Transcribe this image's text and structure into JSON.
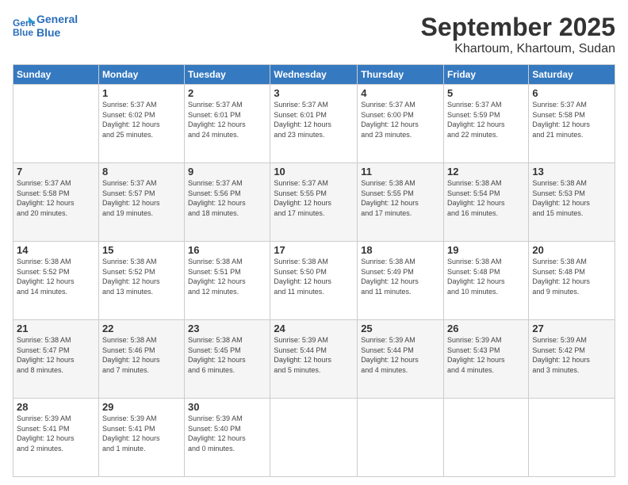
{
  "header": {
    "logo_line1": "General",
    "logo_line2": "Blue",
    "title": "September 2025",
    "subtitle": "Khartoum, Khartoum, Sudan"
  },
  "days_of_week": [
    "Sunday",
    "Monday",
    "Tuesday",
    "Wednesday",
    "Thursday",
    "Friday",
    "Saturday"
  ],
  "weeks": [
    [
      {
        "day": "",
        "info": ""
      },
      {
        "day": "1",
        "info": "Sunrise: 5:37 AM\nSunset: 6:02 PM\nDaylight: 12 hours\nand 25 minutes."
      },
      {
        "day": "2",
        "info": "Sunrise: 5:37 AM\nSunset: 6:01 PM\nDaylight: 12 hours\nand 24 minutes."
      },
      {
        "day": "3",
        "info": "Sunrise: 5:37 AM\nSunset: 6:01 PM\nDaylight: 12 hours\nand 23 minutes."
      },
      {
        "day": "4",
        "info": "Sunrise: 5:37 AM\nSunset: 6:00 PM\nDaylight: 12 hours\nand 23 minutes."
      },
      {
        "day": "5",
        "info": "Sunrise: 5:37 AM\nSunset: 5:59 PM\nDaylight: 12 hours\nand 22 minutes."
      },
      {
        "day": "6",
        "info": "Sunrise: 5:37 AM\nSunset: 5:58 PM\nDaylight: 12 hours\nand 21 minutes."
      }
    ],
    [
      {
        "day": "7",
        "info": "Sunrise: 5:37 AM\nSunset: 5:58 PM\nDaylight: 12 hours\nand 20 minutes."
      },
      {
        "day": "8",
        "info": "Sunrise: 5:37 AM\nSunset: 5:57 PM\nDaylight: 12 hours\nand 19 minutes."
      },
      {
        "day": "9",
        "info": "Sunrise: 5:37 AM\nSunset: 5:56 PM\nDaylight: 12 hours\nand 18 minutes."
      },
      {
        "day": "10",
        "info": "Sunrise: 5:37 AM\nSunset: 5:55 PM\nDaylight: 12 hours\nand 17 minutes."
      },
      {
        "day": "11",
        "info": "Sunrise: 5:38 AM\nSunset: 5:55 PM\nDaylight: 12 hours\nand 17 minutes."
      },
      {
        "day": "12",
        "info": "Sunrise: 5:38 AM\nSunset: 5:54 PM\nDaylight: 12 hours\nand 16 minutes."
      },
      {
        "day": "13",
        "info": "Sunrise: 5:38 AM\nSunset: 5:53 PM\nDaylight: 12 hours\nand 15 minutes."
      }
    ],
    [
      {
        "day": "14",
        "info": "Sunrise: 5:38 AM\nSunset: 5:52 PM\nDaylight: 12 hours\nand 14 minutes."
      },
      {
        "day": "15",
        "info": "Sunrise: 5:38 AM\nSunset: 5:52 PM\nDaylight: 12 hours\nand 13 minutes."
      },
      {
        "day": "16",
        "info": "Sunrise: 5:38 AM\nSunset: 5:51 PM\nDaylight: 12 hours\nand 12 minutes."
      },
      {
        "day": "17",
        "info": "Sunrise: 5:38 AM\nSunset: 5:50 PM\nDaylight: 12 hours\nand 11 minutes."
      },
      {
        "day": "18",
        "info": "Sunrise: 5:38 AM\nSunset: 5:49 PM\nDaylight: 12 hours\nand 11 minutes."
      },
      {
        "day": "19",
        "info": "Sunrise: 5:38 AM\nSunset: 5:48 PM\nDaylight: 12 hours\nand 10 minutes."
      },
      {
        "day": "20",
        "info": "Sunrise: 5:38 AM\nSunset: 5:48 PM\nDaylight: 12 hours\nand 9 minutes."
      }
    ],
    [
      {
        "day": "21",
        "info": "Sunrise: 5:38 AM\nSunset: 5:47 PM\nDaylight: 12 hours\nand 8 minutes."
      },
      {
        "day": "22",
        "info": "Sunrise: 5:38 AM\nSunset: 5:46 PM\nDaylight: 12 hours\nand 7 minutes."
      },
      {
        "day": "23",
        "info": "Sunrise: 5:38 AM\nSunset: 5:45 PM\nDaylight: 12 hours\nand 6 minutes."
      },
      {
        "day": "24",
        "info": "Sunrise: 5:39 AM\nSunset: 5:44 PM\nDaylight: 12 hours\nand 5 minutes."
      },
      {
        "day": "25",
        "info": "Sunrise: 5:39 AM\nSunset: 5:44 PM\nDaylight: 12 hours\nand 4 minutes."
      },
      {
        "day": "26",
        "info": "Sunrise: 5:39 AM\nSunset: 5:43 PM\nDaylight: 12 hours\nand 4 minutes."
      },
      {
        "day": "27",
        "info": "Sunrise: 5:39 AM\nSunset: 5:42 PM\nDaylight: 12 hours\nand 3 minutes."
      }
    ],
    [
      {
        "day": "28",
        "info": "Sunrise: 5:39 AM\nSunset: 5:41 PM\nDaylight: 12 hours\nand 2 minutes."
      },
      {
        "day": "29",
        "info": "Sunrise: 5:39 AM\nSunset: 5:41 PM\nDaylight: 12 hours\nand 1 minute."
      },
      {
        "day": "30",
        "info": "Sunrise: 5:39 AM\nSunset: 5:40 PM\nDaylight: 12 hours\nand 0 minutes."
      },
      {
        "day": "",
        "info": ""
      },
      {
        "day": "",
        "info": ""
      },
      {
        "day": "",
        "info": ""
      },
      {
        "day": "",
        "info": ""
      }
    ]
  ]
}
